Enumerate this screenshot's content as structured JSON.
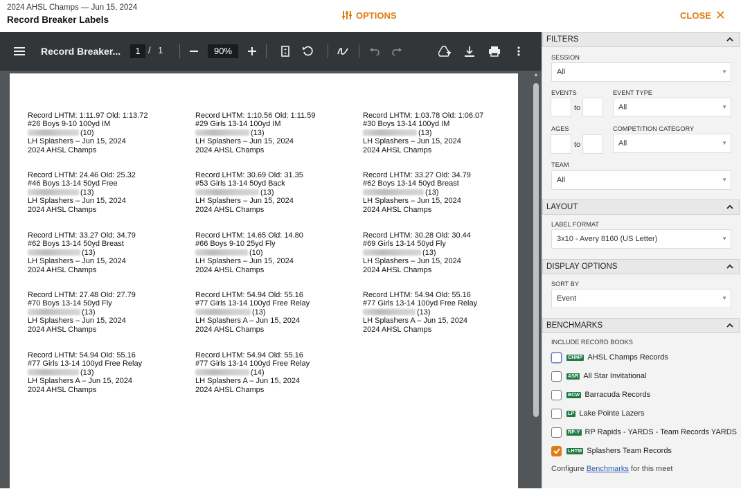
{
  "header": {
    "subtitle": "2024 AHSL Champs — Jun 15, 2024",
    "title": "Record Breaker Labels",
    "options_label": "OPTIONS",
    "close_label": "CLOSE",
    "accent_color": "#e07b14"
  },
  "pdf_toolbar": {
    "menu_icon": "hamburger-menu-icon",
    "doc_title": "Record Breaker...",
    "page_current": "1",
    "page_separator": "/",
    "page_total": "1",
    "zoom_out_icon": "minus-icon",
    "zoom": "90%",
    "zoom_in_icon": "plus-icon",
    "fit_icon": "fit-page-icon",
    "rotate_icon": "rotate-icon",
    "annotate_icon": "draw-icon",
    "undo_icon": "undo-icon",
    "redo_icon": "redo-icon",
    "drive_icon": "add-to-drive-icon",
    "download_icon": "download-icon",
    "print_icon": "print-icon",
    "more_icon": "more-vert-icon"
  },
  "labels": [
    {
      "l1": "Record LHTM: 1:11.97 Old: 1:13.72",
      "l2": "#26 Boys 9-10 100yd IM",
      "l3": "(10)",
      "l4": "LH Splashers – Jun 15, 2024",
      "l5": "2024 AHSL Champs"
    },
    {
      "l1": "Record LHTM: 1:10.56 Old: 1:11.59",
      "l2": "#29 Girls 13-14 100yd IM",
      "l3": "(13)",
      "l4": "LH Splashers – Jun 15, 2024",
      "l5": "2024 AHSL Champs"
    },
    {
      "l1": "Record LHTM: 1:03.78 Old: 1:06.07",
      "l2": "#30 Boys 13-14 100yd IM",
      "l3": "(13)",
      "l4": "LH Splashers – Jun 15, 2024",
      "l5": "2024 AHSL Champs"
    },
    {
      "l1": "Record LHTM: 24.46 Old: 25.32",
      "l2": "#46 Boys 13-14 50yd Free",
      "l3": "(13)",
      "l4": "LH Splashers – Jun 15, 2024",
      "l5": "2024 AHSL Champs"
    },
    {
      "l1": "Record LHTM: 30.69 Old: 31.35",
      "l2": "#53 Girls 13-14 50yd Back",
      "l3": "(13)",
      "l4": "LH Splashers – Jun 15, 2024",
      "l5": "2024 AHSL Champs"
    },
    {
      "l1": "Record LHTM: 33.27 Old: 34.79",
      "l2": "#62 Boys 13-14 50yd Breast",
      "l3": "(13)",
      "l4": "LH Splashers – Jun 15, 2024",
      "l5": "2024 AHSL Champs"
    },
    {
      "l1": "Record LHTM: 33.27 Old: 34.79",
      "l2": "#62 Boys 13-14 50yd Breast",
      "l3": "(13)",
      "l4": "LH Splashers – Jun 15, 2024",
      "l5": "2024 AHSL Champs"
    },
    {
      "l1": "Record LHTM: 14.65 Old: 14.80",
      "l2": "#66 Boys 9-10 25yd Fly",
      "l3": "(10)",
      "l4": "LH Splashers – Jun 15, 2024",
      "l5": "2024 AHSL Champs"
    },
    {
      "l1": "Record LHTM: 30.28 Old: 30.44",
      "l2": "#69 Girls 13-14 50yd Fly",
      "l3": "(13)",
      "l4": "LH Splashers – Jun 15, 2024",
      "l5": "2024 AHSL Champs"
    },
    {
      "l1": "Record LHTM: 27.48 Old: 27.79",
      "l2": "#70 Boys 13-14 50yd Fly",
      "l3": "(13)",
      "l4": "LH Splashers – Jun 15, 2024",
      "l5": "2024 AHSL Champs"
    },
    {
      "l1": "Record LHTM: 54.94 Old: 55.16",
      "l2": "#77 Girls 13-14 100yd Free Relay",
      "l3": "(13)",
      "l4": "LH Splashers A – Jun 15, 2024",
      "l5": "2024 AHSL Champs"
    },
    {
      "l1": "Record LHTM: 54.94 Old: 55.16",
      "l2": "#77 Girls 13-14 100yd Free Relay",
      "l3": "(13)",
      "l4": "LH Splashers A – Jun 15, 2024",
      "l5": "2024 AHSL Champs"
    },
    {
      "l1": "Record LHTM: 54.94 Old: 55.16",
      "l2": "#77 Girls 13-14 100yd Free Relay",
      "l3": "(13)",
      "l4": "LH Splashers A – Jun 15, 2024",
      "l5": "2024 AHSL Champs"
    },
    {
      "l1": "Record LHTM: 54.94 Old: 55.16",
      "l2": "#77 Girls 13-14 100yd Free Relay",
      "l3": "(14)",
      "l4": "LH Splashers A – Jun 15, 2024",
      "l5": "2024 AHSL Champs"
    }
  ],
  "panel": {
    "filters": {
      "heading": "FILTERS",
      "session_label": "SESSION",
      "session_value": "All",
      "events_label": "EVENTS",
      "events_to": "to",
      "event_type_label": "EVENT TYPE",
      "event_type_value": "All",
      "ages_label": "AGES",
      "ages_to": "to",
      "competition_label": "COMPETITION CATEGORY",
      "competition_value": "All",
      "team_label": "TEAM",
      "team_value": "All"
    },
    "layout": {
      "heading": "LAYOUT",
      "label_format_label": "LABEL FORMAT",
      "label_format_value": "3x10 - Avery 8160 (US Letter)"
    },
    "display": {
      "heading": "DISPLAY OPTIONS",
      "sort_label": "SORT BY",
      "sort_value": "Event"
    },
    "benchmarks": {
      "heading": "BENCHMARKS",
      "include_label": "INCLUDE RECORD BOOKS",
      "items": [
        {
          "badge": "CHMP",
          "label": "AHSL Champs Records",
          "checked": false
        },
        {
          "badge": "ASR",
          "label": "All Star Invitational",
          "checked": false
        },
        {
          "badge": "BCW",
          "label": "Barracuda Records",
          "checked": false
        },
        {
          "badge": "LP",
          "label": "Lake Pointe Lazers",
          "checked": false
        },
        {
          "badge": "RP-Y",
          "label": "RP Rapids - YARDS - Team Records YARDS",
          "checked": false
        },
        {
          "badge": "LHTM",
          "label": "Splashers Team Records",
          "checked": true
        }
      ],
      "configure_prefix": "Configure",
      "configure_link": "Benchmarks",
      "configure_suffix": "for this meet",
      "badge_color": "#1f7a45"
    }
  }
}
